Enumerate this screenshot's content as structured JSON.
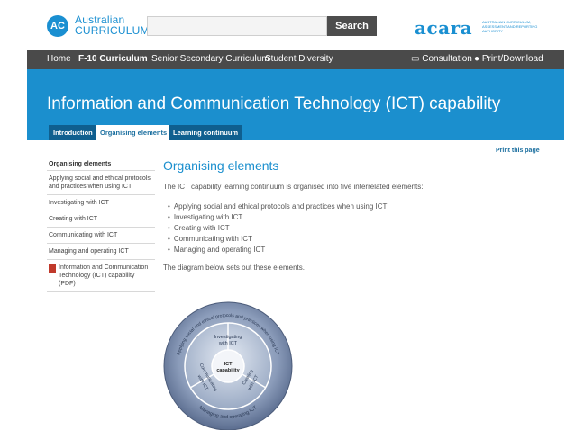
{
  "header": {
    "logo_mark": "AC",
    "logo_line1": "Australian",
    "logo_line2": "CURRICULUM",
    "search_placeholder": "",
    "search_label": "Search",
    "acara_logo": "acara",
    "acara_tagline": "AUSTRALIAN CURRICULUM, ASSESSMENT AND REPORTING AUTHORITY"
  },
  "nav": {
    "items": [
      "Home",
      "F-10 Curriculum",
      "Senior Secondary Curriculum",
      "Student Diversity"
    ],
    "active": "F-10 Curriculum",
    "right": [
      "Consultation",
      "Print/Download"
    ]
  },
  "banner": {
    "title": "Information and Communication Technology (ICT) capability",
    "tabs": [
      "Introduction",
      "Organising elements",
      "Learning continuum"
    ],
    "active_tab": "Organising elements"
  },
  "print_link": "Print this page",
  "sidebar": {
    "heading": "Organising elements",
    "items": [
      "Applying social and ethical protocols and practices when using ICT",
      "Investigating with ICT",
      "Creating with ICT",
      "Communicating with ICT",
      "Managing and operating ICT"
    ],
    "pdf_link": "Information and Communication Technology (ICT) capability (PDF)"
  },
  "content": {
    "title": "Organising elements",
    "intro": "The ICT capability learning continuum is organised into five interrelated elements:",
    "bullets": [
      "Applying social and ethical protocols and practices when using ICT",
      "Investigating with ICT",
      "Creating with ICT",
      "Communicating with ICT",
      "Managing and operating ICT"
    ],
    "diagram_intro": "The diagram below sets out these elements."
  },
  "diagram": {
    "center_line1": "ICT",
    "center_line2": "capability",
    "outer_top": "Applying social and ethical protocols and practices when using ICT",
    "outer_bottom": "Managing and operating ICT",
    "segment_top_line1": "Investigating",
    "segment_top_line2": "with ICT",
    "segment_left_line1": "Communicating",
    "segment_left_line2": "with ICT",
    "segment_right_line1": "Creating",
    "segment_right_line2": "with ICT"
  },
  "colors": {
    "brand_blue": "#1b8fce",
    "nav_dark": "#4a4a4a",
    "tab_dark": "#0f5f8f"
  }
}
